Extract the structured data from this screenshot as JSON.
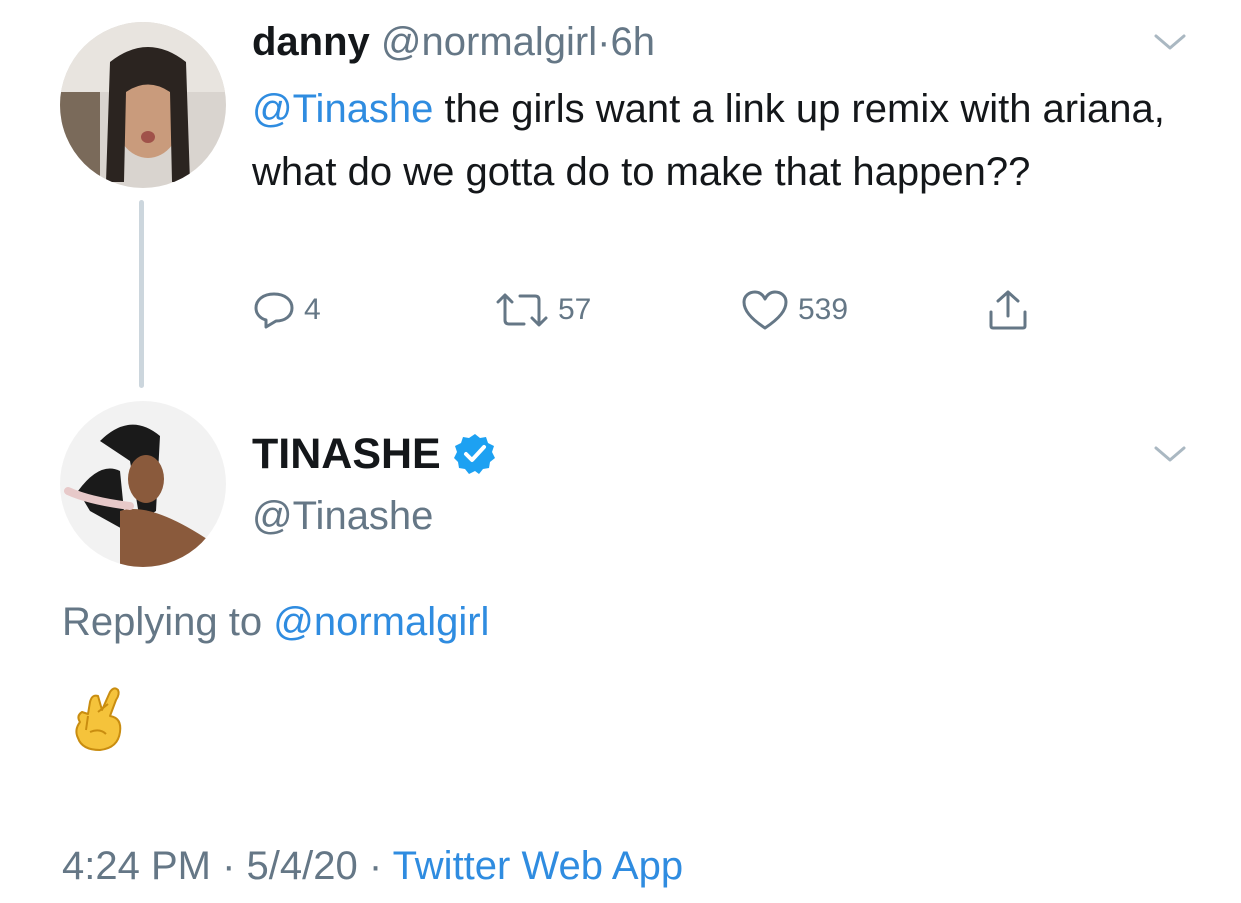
{
  "tweet1": {
    "display_name": "danny",
    "handle": "@normalgirl",
    "separator": "·",
    "time": "6h",
    "mention": "@Tinashe",
    "text": " the girls want a link up remix with ariana, what do we gotta do to make that happen??",
    "actions": {
      "reply_count": "4",
      "retweet_count": "57",
      "like_count": "539"
    },
    "avatar_icon": "user-avatar-photo"
  },
  "tweet2": {
    "display_name": "TINASHE",
    "verified": true,
    "handle": "@Tinashe",
    "replying_prefix": "Replying to ",
    "replying_handle": "@normalgirl",
    "content_emoji": "🤞",
    "time": "4:24 PM",
    "sep1": " · ",
    "date": "5/4/20",
    "sep2": " · ",
    "source": "Twitter Web App",
    "avatar_icon": "user-avatar-photo"
  },
  "colors": {
    "text": "#14171a",
    "secondary": "#657786",
    "link": "#2f8ce0",
    "thread_line": "#ccd6dd",
    "verified": "#1da1f2"
  }
}
